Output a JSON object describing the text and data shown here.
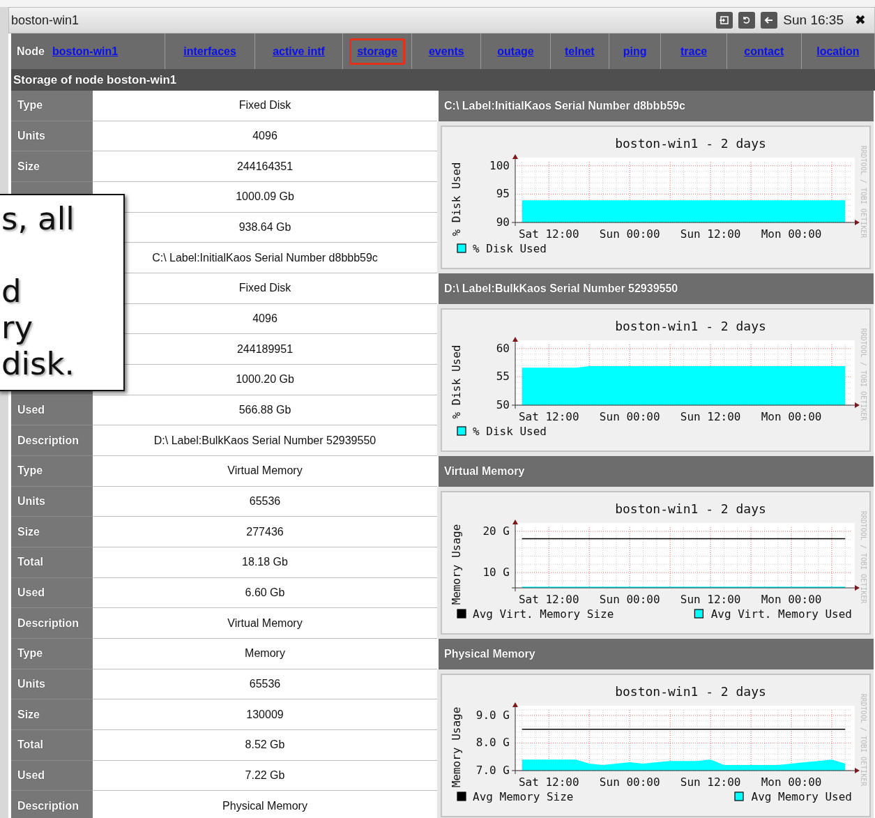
{
  "window": {
    "title": "boston-win1",
    "clock": "Sun 16:35",
    "close": "✖"
  },
  "nav": {
    "label": "Node",
    "items": [
      {
        "label": "boston-win1",
        "selected": false
      },
      {
        "label": "interfaces",
        "selected": false
      },
      {
        "label": "active intf",
        "selected": false
      },
      {
        "label": "storage",
        "selected": true
      },
      {
        "label": "events",
        "selected": false
      },
      {
        "label": "outage",
        "selected": false
      },
      {
        "label": "telnet",
        "selected": false
      },
      {
        "label": "ping",
        "selected": false
      },
      {
        "label": "trace",
        "selected": false
      },
      {
        "label": "contact",
        "selected": false
      },
      {
        "label": "location",
        "selected": false
      }
    ]
  },
  "heading": "Storage of node boston-win1",
  "storages": [
    {
      "header": "C:\\ Label:InitialKaos Serial Number d8bbb59c",
      "rows": [
        {
          "label": "Type",
          "value": "Fixed Disk"
        },
        {
          "label": "Units",
          "value": "4096"
        },
        {
          "label": "Size",
          "value": "244164351"
        },
        {
          "value": "1000.09 Gb"
        },
        {
          "value": "938.64 Gb"
        },
        {
          "value": "C:\\ Label:InitialKaos Serial Number d8bbb59c"
        }
      ],
      "chart": {
        "chart_data": {
          "type": "area",
          "title": "boston-win1 - 2 days",
          "ylabel": "% Disk Used",
          "ylim": [
            90,
            100.7
          ],
          "grid": true,
          "legend": "bottom",
          "yticks": [
            90,
            95,
            100
          ],
          "categories": [
            null,
            null,
            "Sat 12:00",
            null,
            null,
            null,
            null,
            null,
            "Sun 00:00",
            null,
            null,
            null,
            null,
            null,
            "Sun 12:00",
            null,
            null,
            null,
            null,
            null,
            "Mon 00:00",
            null,
            null,
            null,
            null
          ],
          "series": [
            {
              "name": "% Disk Used",
              "color": "#00ffff",
              "values": [
                93.9,
                93.9,
                93.9,
                93.9,
                93.9,
                93.9,
                93.9,
                93.9,
                93.9,
                93.9,
                93.9,
                93.9,
                93.9,
                93.9,
                93.9,
                93.9,
                93.9,
                93.9,
                93.9,
                93.9,
                93.9,
                93.9,
                93.9,
                93.9,
                93.9
              ]
            }
          ]
        },
        "credit": "RRDTOOL / TOBI OETIKER"
      }
    },
    {
      "header": "D:\\ Label:BulkKaos Serial Number 52939550",
      "rows": [
        {
          "value": "Fixed Disk"
        },
        {
          "value": "4096"
        },
        {
          "value": "244189951"
        },
        {
          "value": "1000.20 Gb"
        },
        {
          "label": "Used",
          "value": "566.88 Gb"
        },
        {
          "label": "Description",
          "value": "D:\\ Label:BulkKaos Serial Number 52939550"
        }
      ],
      "chart": {
        "chart_data": {
          "type": "area",
          "title": "boston-win1 - 2 days",
          "ylabel": "% Disk Used",
          "ylim": [
            50,
            60.7
          ],
          "grid": true,
          "legend": "bottom",
          "yticks": [
            50,
            55,
            60
          ],
          "categories": [
            null,
            null,
            "Sat 12:00",
            null,
            null,
            null,
            null,
            null,
            "Sun 00:00",
            null,
            null,
            null,
            null,
            null,
            "Sun 12:00",
            null,
            null,
            null,
            null,
            null,
            "Mon 00:00",
            null,
            null,
            null,
            null
          ],
          "series": [
            {
              "name": "% Disk Used",
              "color": "#00ffff",
              "values": [
                56.6,
                56.6,
                56.6,
                56.6,
                56.6,
                56.9,
                56.9,
                56.9,
                56.9,
                56.9,
                56.9,
                56.9,
                56.9,
                56.9,
                56.9,
                56.9,
                56.9,
                56.9,
                56.9,
                56.9,
                56.9,
                56.9,
                56.9,
                56.9,
                56.9
              ]
            }
          ]
        },
        "credit": "RRDTOOL / TOBI OETIKER"
      }
    },
    {
      "header": "Virtual Memory",
      "rows": [
        {
          "label": "Type",
          "value": "Virtual Memory"
        },
        {
          "label": "Units",
          "value": "65536"
        },
        {
          "label": "Size",
          "value": "277436"
        },
        {
          "label": "Total",
          "value": "18.18 Gb"
        },
        {
          "label": "Used",
          "value": "6.60 Gb"
        },
        {
          "label": "Description",
          "value": "Virtual Memory"
        }
      ],
      "chart": {
        "chart_data": {
          "type": "area",
          "title": "boston-win1 - 2 days",
          "ylabel": "Memory Usage",
          "ylim": [
            6.3,
            21
          ],
          "yticks": [
            {
              "value": 10,
              "label": "10 G"
            },
            {
              "value": 20,
              "label": "20 G"
            }
          ],
          "categories": [
            null,
            null,
            "Sat 12:00",
            null,
            null,
            null,
            null,
            null,
            "Sun 00:00",
            null,
            null,
            null,
            null,
            null,
            "Sun 12:00",
            null,
            null,
            null,
            null,
            null,
            "Mon 00:00",
            null,
            null,
            null,
            null
          ],
          "grid": true,
          "legend": "bottom",
          "series": [
            {
              "name": "Avg Virt. Memory Size",
              "color": "#000000",
              "type": "line",
              "values": [
                18.2,
                18.2,
                18.2,
                18.2,
                18.2,
                18.2,
                18.2,
                18.2,
                18.2,
                18.2,
                18.2,
                18.2,
                18.2,
                18.2,
                18.2,
                18.2,
                18.2,
                18.2,
                18.2,
                18.2,
                18.2,
                18.2,
                18.2,
                18.2,
                18.2
              ]
            },
            {
              "name": "Avg Virt. Memory Used",
              "color": "#00ffff",
              "values": [
                6.6,
                6.6,
                6.6,
                6.6,
                6.6,
                6.6,
                6.6,
                6.6,
                6.6,
                6.6,
                6.6,
                6.6,
                6.6,
                6.6,
                6.6,
                6.6,
                6.6,
                6.6,
                6.6,
                6.6,
                6.6,
                6.6,
                6.6,
                6.6,
                6.6
              ]
            }
          ]
        },
        "credit": "RRDTOOL / TOBI OETIKER"
      }
    },
    {
      "header": "Physical Memory",
      "rows": [
        {
          "label": "Type",
          "value": "Memory"
        },
        {
          "label": "Units",
          "value": "65536"
        },
        {
          "label": "Size",
          "value": "130009"
        },
        {
          "label": "Total",
          "value": "8.52 Gb"
        },
        {
          "label": "Used",
          "value": "7.22 Gb"
        },
        {
          "label": "Description",
          "value": "Physical Memory"
        }
      ],
      "chart": {
        "chart_data": {
          "type": "area",
          "title": "boston-win1 - 2 days",
          "ylabel": "Memory Usage",
          "ylim": [
            7,
            9.2
          ],
          "yticks": [
            {
              "value": 7,
              "label": "7.0 G"
            },
            {
              "value": 8,
              "label": "8.0 G"
            },
            {
              "value": 9,
              "label": "9.0 G"
            }
          ],
          "categories": [
            null,
            null,
            "Sat 12:00",
            null,
            null,
            null,
            null,
            null,
            "Sun 00:00",
            null,
            null,
            null,
            null,
            null,
            "Sun 12:00",
            null,
            null,
            null,
            null,
            null,
            "Mon 00:00",
            null,
            null,
            null,
            null
          ],
          "grid": true,
          "legend": "bottom",
          "series": [
            {
              "name": "Avg Memory Size",
              "color": "#000000",
              "type": "line",
              "values": [
                8.5,
                8.5,
                8.5,
                8.5,
                8.5,
                8.5,
                8.5,
                8.5,
                8.5,
                8.5,
                8.5,
                8.5,
                8.5,
                8.5,
                8.5,
                8.5,
                8.5,
                8.5,
                8.5,
                8.5,
                8.5,
                8.5,
                8.5,
                8.5,
                8.5
              ]
            },
            {
              "name": "Avg Memory Used",
              "color": "#00ffff",
              "values": [
                7.4,
                7.4,
                7.4,
                7.4,
                7.4,
                7.25,
                7.2,
                7.25,
                7.3,
                7.25,
                7.3,
                7.35,
                7.35,
                7.35,
                7.4,
                7.2,
                7.2,
                7.2,
                7.2,
                7.2,
                7.25,
                7.3,
                7.35,
                7.4,
                7.25
              ]
            }
          ]
        },
        "credit": "RRDTOOL / TOBI OETIKER"
      }
    }
  ],
  "callout": {
    "paragraphs": [
      [
        "s, all"
      ],
      [
        "d",
        "ry",
        "disk."
      ]
    ]
  }
}
